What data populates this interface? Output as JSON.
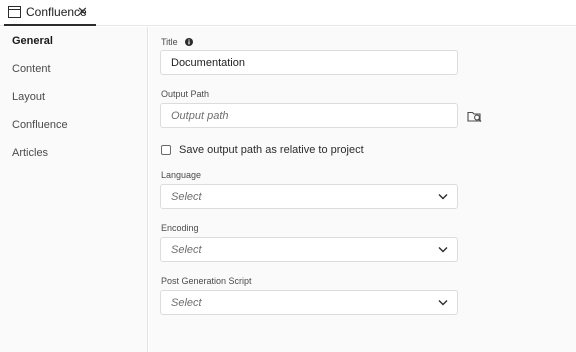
{
  "tabbar": {
    "tab_label": "Confluence",
    "close_glyph": "✕"
  },
  "sidebar": {
    "items": [
      {
        "label": "General",
        "active": true
      },
      {
        "label": "Content"
      },
      {
        "label": "Layout"
      },
      {
        "label": "Confluence"
      },
      {
        "label": "Articles"
      }
    ]
  },
  "form": {
    "title_label": "Title",
    "title_value": "Documentation",
    "output_path_label": "Output Path",
    "output_path_placeholder": "Output path",
    "relative_checkbox_label": "Save output path as relative to project",
    "relative_checked": false,
    "language_label": "Language",
    "language_value": "Select",
    "encoding_label": "Encoding",
    "encoding_value": "Select",
    "script_label": "Post Generation Script",
    "script_value": "Select"
  },
  "icons": {
    "tab": "window-icon",
    "close": "close-icon",
    "info": "info-icon",
    "browse": "folder-search-icon",
    "chevron": "chevron-down-icon"
  }
}
